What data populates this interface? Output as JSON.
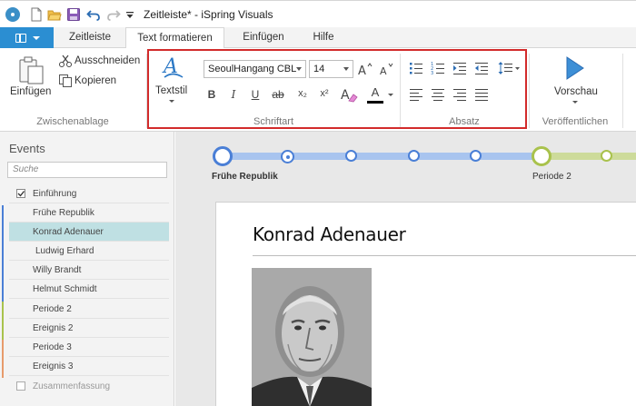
{
  "window": {
    "title": "Zeitleiste* - iSpring Visuals"
  },
  "tabs": [
    {
      "label": "Zeitleiste"
    },
    {
      "label": "Text formatieren"
    },
    {
      "label": "Einfügen"
    },
    {
      "label": "Hilfe"
    }
  ],
  "ribbon": {
    "clipboard": {
      "paste_label": "Einfügen",
      "cut_label": "Ausschneiden",
      "copy_label": "Kopieren",
      "group_label": "Zwischenablage"
    },
    "font": {
      "style_label": "Textstil",
      "font_name": "SeoulHangang CBL",
      "font_size": "14",
      "group_label": "Schriftart",
      "bold": "B",
      "italic": "I",
      "underline": "U",
      "strike": "ab",
      "subscript": "x₂",
      "superscript": "x²",
      "font_color_letter": "A"
    },
    "paragraph": {
      "group_label": "Absatz"
    },
    "publish": {
      "preview_label": "Vorschau",
      "group_label": "Veröffentlichen"
    }
  },
  "events_panel": {
    "title": "Events",
    "search_placeholder": "Suche",
    "items": [
      {
        "label": "Einführung",
        "checked": true
      },
      {
        "label": "Frühe Republik"
      },
      {
        "label": "Konrad Adenauer",
        "selected": true
      },
      {
        "label": "Ludwig Erhard"
      },
      {
        "label": "Willy Brandt"
      },
      {
        "label": "Helmut Schmidt"
      },
      {
        "label": "Periode 2"
      },
      {
        "label": "Ereignis 2"
      },
      {
        "label": "Periode 3"
      },
      {
        "label": "Ereignis 3"
      },
      {
        "label": "Zusammenfassung",
        "checked": false
      }
    ]
  },
  "timeline": {
    "label_1": "Frühe Republik",
    "label_2": "Periode 2"
  },
  "slide": {
    "title": "Konrad Adenauer"
  },
  "colors": {
    "accent_blue": "#2b8ed2",
    "timeline_blue": "#a8c4ef",
    "node_blue": "#4a7fd6",
    "timeline_green": "#cddb9a",
    "node_green": "#a9c24c",
    "selection": "#bfe0e3",
    "highlight_red": "#d22b2b"
  }
}
